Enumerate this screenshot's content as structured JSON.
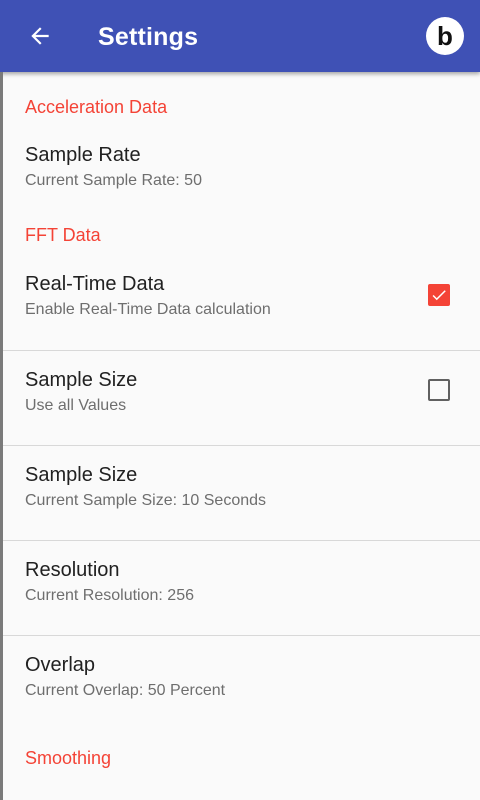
{
  "appbar": {
    "title": "Settings",
    "back_icon": "arrow-back-icon",
    "avatar_letter": "b",
    "color": "#3f51b5"
  },
  "accent_color": "#f44336",
  "categories": [
    {
      "title": "Acceleration Data"
    },
    {
      "title": "FFT Data"
    },
    {
      "title": "Smoothing"
    }
  ],
  "preferences": [
    {
      "title": "Sample Rate",
      "summary": "Current Sample Rate: 50"
    },
    {
      "title": "Real-Time Data",
      "summary": "Enable Real-Time Data calculation",
      "checked": true
    },
    {
      "title": "Sample Size",
      "summary": "Use all Values",
      "checked": false
    },
    {
      "title": "Sample Size",
      "summary": "Current Sample Size: 10 Seconds"
    },
    {
      "title": "Resolution",
      "summary": "Current Resolution: 256"
    },
    {
      "title": "Overlap",
      "summary": "Current Overlap: 50 Percent"
    }
  ]
}
